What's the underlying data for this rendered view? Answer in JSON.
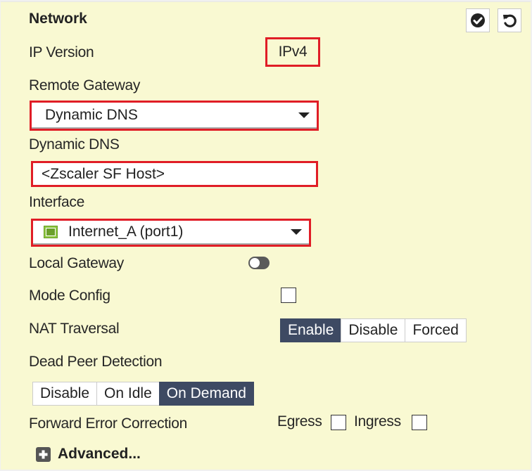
{
  "section": {
    "title": "Network",
    "actions": [
      {
        "name": "apply",
        "icon": "check-circle-icon"
      },
      {
        "name": "revert",
        "icon": "undo-icon"
      }
    ]
  },
  "fields": {
    "ip_version": {
      "label": "IP Version",
      "value": "IPv4"
    },
    "remote_gateway": {
      "label": "Remote Gateway",
      "selected": "Dynamic DNS"
    },
    "dynamic_dns": {
      "label": "Dynamic DNS",
      "value": "<Zscaler SF Host>"
    },
    "interface": {
      "label": "Interface",
      "selected": "Internet_A (port1)",
      "icon": "network-port-icon"
    },
    "local_gateway": {
      "label": "Local Gateway",
      "enabled": false
    },
    "mode_config": {
      "label": "Mode Config",
      "checked": false
    },
    "nat_traversal": {
      "label": "NAT Traversal",
      "options": [
        "Enable",
        "Disable",
        "Forced"
      ],
      "selected": "Enable"
    },
    "dead_peer_detection": {
      "label": "Dead Peer Detection",
      "options": [
        "Disable",
        "On Idle",
        "On Demand"
      ],
      "selected": "On Demand"
    },
    "forward_error_correction": {
      "label": "Forward Error Correction",
      "egress_label": "Egress",
      "egress_checked": false,
      "ingress_label": "Ingress",
      "ingress_checked": false
    }
  },
  "advanced": {
    "label": "Advanced...",
    "icon": "plus-square-icon"
  },
  "colors": {
    "background": "#f9f9d2",
    "highlight": "#e01d26",
    "active_segment": "#3e4a63"
  }
}
